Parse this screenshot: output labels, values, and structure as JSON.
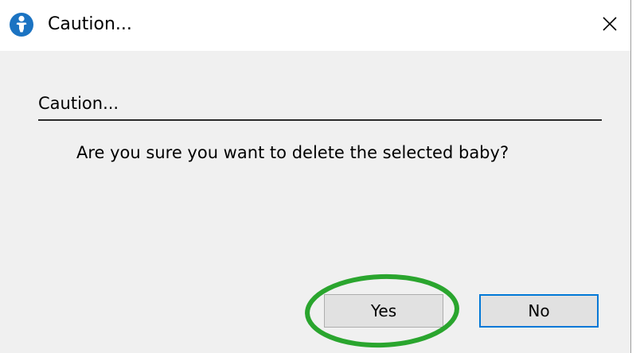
{
  "window": {
    "title": "Caution...",
    "icon": "baby-icon",
    "close_icon": "close-icon"
  },
  "content": {
    "section_label": "Caution...",
    "message": "Are you sure you want to delete the selected baby?"
  },
  "buttons": {
    "yes_label": "Yes",
    "no_label": "No"
  },
  "colors": {
    "icon_blue": "#1b73c2",
    "focus_border": "#0078d7",
    "highlight_green": "#2aa52e"
  }
}
